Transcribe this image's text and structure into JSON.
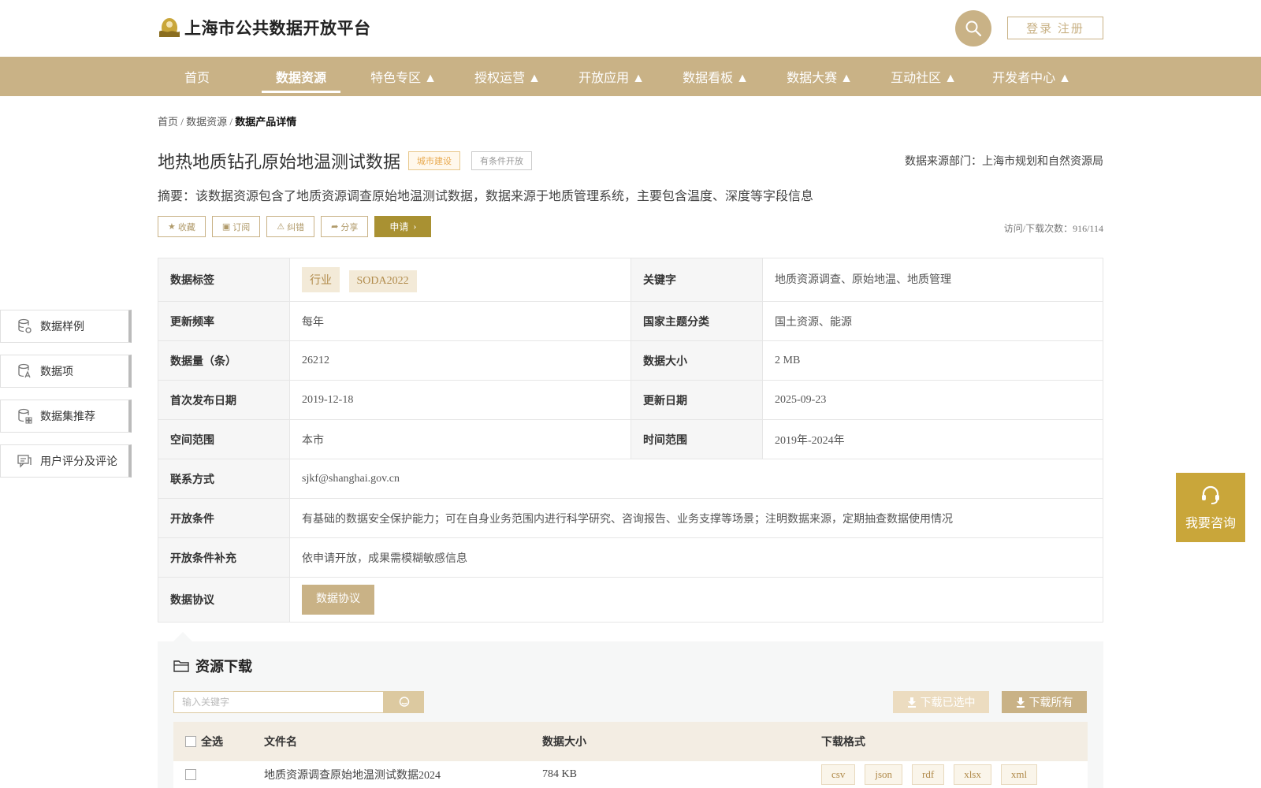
{
  "header": {
    "site_title": "上海市公共数据开放平台",
    "login_label": "登录 注册"
  },
  "nav": {
    "items": [
      {
        "label": "首页"
      },
      {
        "label": "数据资源",
        "active": true
      },
      {
        "label": "特色专区 ▲"
      },
      {
        "label": "授权运营 ▲"
      },
      {
        "label": "开放应用 ▲"
      },
      {
        "label": "数据看板 ▲"
      },
      {
        "label": "数据大赛 ▲"
      },
      {
        "label": "互动社区 ▲"
      },
      {
        "label": "开发者中心 ▲"
      }
    ]
  },
  "breadcrumb": {
    "home": "首页",
    "sep": "/",
    "resources": "数据资源",
    "current": "数据产品详情"
  },
  "dataset": {
    "title": "地热地质钻孔原始地温测试数据",
    "tag_category": "城市建设",
    "tag_access": "有条件开放",
    "source": "数据来源部门：上海市规划和自然资源局",
    "summary": "摘要：该数据资源包含了地质资源调查原始地温测试数据，数据来源于地质管理系统，主要包含温度、深度等字段信息",
    "visits": "访问/下载次数：916/114"
  },
  "actions": {
    "favorite": "收藏",
    "subscribe": "订阅",
    "correct": "纠错",
    "share": "分享",
    "apply": "申请"
  },
  "info": {
    "tags_label": "数据标签",
    "tags": [
      "行业",
      "SODA2022"
    ],
    "keywords_label": "关键字",
    "keywords": "地质资源调查、原始地温、地质管理",
    "freq_label": "更新频率",
    "freq": "每年",
    "theme_label": "国家主题分类",
    "theme": "国土资源、能源",
    "count_label": "数据量（条）",
    "count": "26212",
    "size_label": "数据大小",
    "size": "2 MB",
    "first_pub_label": "首次发布日期",
    "first_pub": "2019-12-18",
    "update_label": "更新日期",
    "update": "2025-09-23",
    "space_label": "空间范围",
    "space": "本市",
    "time_label": "时间范围",
    "time": "2019年-2024年",
    "contact_label": "联系方式",
    "contact": "sjkf@shanghai.gov.cn",
    "cond_label": "开放条件",
    "cond": "有基础的数据安全保护能力；可在自身业务范围内进行科学研究、咨询报告、业务支撑等场景；注明数据来源，定期抽查数据使用情况",
    "cond_extra_label": "开放条件补充",
    "cond_extra": "依申请开放，成果需模糊敏感信息",
    "agreement_label": "数据协议",
    "agreement_btn": "数据协议"
  },
  "side": {
    "items": [
      {
        "label": "数据样例"
      },
      {
        "label": "数据项"
      },
      {
        "label": "数据集推荐"
      },
      {
        "label": "用户评分及评论"
      }
    ]
  },
  "consult": {
    "label": "我要咨询"
  },
  "download": {
    "title": "资源下载",
    "search_placeholder": "输入关键字",
    "download_selected": "下载已选中",
    "download_all": "下载所有",
    "col_select_all": "全选",
    "col_filename": "文件名",
    "col_size": "数据大小",
    "col_format": "下载格式",
    "rows": [
      {
        "filename": "地质资源调查原始地温测试数据2024",
        "size": "784 KB",
        "formats": [
          "csv",
          "json",
          "rdf",
          "xlsx",
          "xml"
        ]
      }
    ]
  },
  "colors": {
    "brand": "#c9b286",
    "apply": "#a99132",
    "consult": "#c9a63a"
  }
}
